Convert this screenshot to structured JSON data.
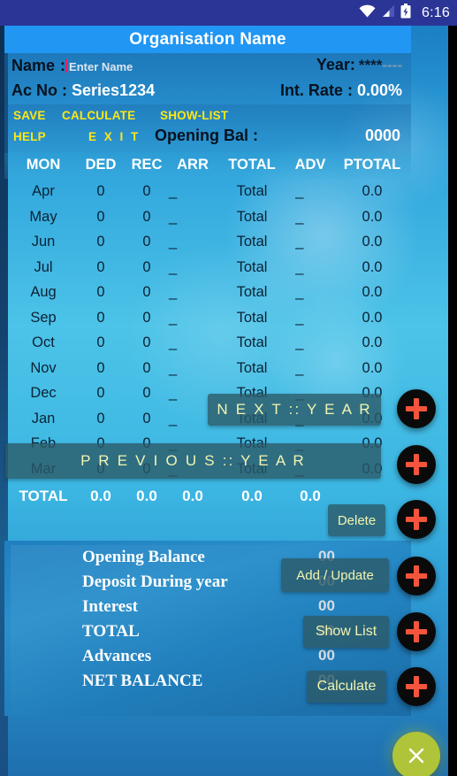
{
  "statusbar": {
    "time": "6:16",
    "icons": [
      "wifi-icon",
      "signal-icon",
      "battery-charging-icon"
    ]
  },
  "header": {
    "title": "Organisation Name",
    "name_label": "Name",
    "name_colon": ":",
    "name_placeholder": "Enter Name",
    "name_value": "",
    "year_label": "Year:",
    "year_stars": "****",
    "year_dashes": "----",
    "acno_label": "Ac No",
    "acno_colon": ":",
    "acno_value": "Series1234",
    "rate_label": "Int. Rate",
    "rate_colon": ":",
    "rate_value": "0.00%"
  },
  "menu": {
    "save": "SAVE",
    "calculate": "CALCULATE",
    "show_list": "SHOW-LIST",
    "help": "HELP",
    "exit": "E X I T",
    "opening_bal_label": "Opening Bal :",
    "opening_bal_value": "0000"
  },
  "table": {
    "columns": [
      "MON",
      "DED",
      "REC",
      "ARR",
      "TOTAL",
      "ADV",
      "PTOTAL"
    ],
    "rows": [
      {
        "mon": "Apr",
        "ded": "0",
        "rec": "0",
        "arr": "_",
        "total": "Total",
        "adv": "_",
        "ptotal": "0.0"
      },
      {
        "mon": "May",
        "ded": "0",
        "rec": "0",
        "arr": "_",
        "total": "Total",
        "adv": "_",
        "ptotal": "0.0"
      },
      {
        "mon": "Jun",
        "ded": "0",
        "rec": "0",
        "arr": "_",
        "total": "Total",
        "adv": "_",
        "ptotal": "0.0"
      },
      {
        "mon": "Jul",
        "ded": "0",
        "rec": "0",
        "arr": "_",
        "total": "Total",
        "adv": "_",
        "ptotal": "0.0"
      },
      {
        "mon": "Aug",
        "ded": "0",
        "rec": "0",
        "arr": "_",
        "total": "Total",
        "adv": "_",
        "ptotal": "0.0"
      },
      {
        "mon": "Sep",
        "ded": "0",
        "rec": "0",
        "arr": "_",
        "total": "Total",
        "adv": "_",
        "ptotal": "0.0"
      },
      {
        "mon": "Oct",
        "ded": "0",
        "rec": "0",
        "arr": "_",
        "total": "Total",
        "adv": "_",
        "ptotal": "0.0"
      },
      {
        "mon": "Nov",
        "ded": "0",
        "rec": "0",
        "arr": "_",
        "total": "Total",
        "adv": "_",
        "ptotal": "0.0"
      },
      {
        "mon": "Dec",
        "ded": "0",
        "rec": "0",
        "arr": "_",
        "total": "Total",
        "adv": "_",
        "ptotal": "0.0"
      },
      {
        "mon": "Jan",
        "ded": "0",
        "rec": "0",
        "arr": "_",
        "total": "Total",
        "adv": "_",
        "ptotal": "0.0"
      },
      {
        "mon": "Feb",
        "ded": "0",
        "rec": "0",
        "arr": "_",
        "total": "Total",
        "adv": "_",
        "ptotal": "0.0"
      },
      {
        "mon": "Mar",
        "ded": "0",
        "rec": "0",
        "arr": "_",
        "total": "Total",
        "adv": "_",
        "ptotal": "0.0"
      }
    ],
    "total_row": {
      "mon": "TOTAL",
      "ded": "0.0",
      "rec": "0.0",
      "arr": "0.0",
      "total": "0.0",
      "adv": "0.0",
      "ptotal": ""
    }
  },
  "summary": {
    "rows": [
      {
        "label": "Opening Balance",
        "value": "00"
      },
      {
        "label": "Deposit During year",
        "value": "00"
      },
      {
        "label": "Interest",
        "value": "00"
      },
      {
        "label": "TOTAL",
        "value": "00"
      },
      {
        "label": "Advances",
        "value": "00"
      },
      {
        "label": "NET BALANCE",
        "value": "00"
      }
    ]
  },
  "overlay_buttons": {
    "next_year": "N E X T :: Y E A R",
    "previous_year": "P R E V I O U S :: Y E A R",
    "delete": "Delete",
    "add_update": "Add / Update",
    "show_list": "Show List",
    "calculate": "Calculate"
  },
  "fab": {
    "add_icon": "plus-icon",
    "close_icon": "close-icon",
    "count": 6
  },
  "colors": {
    "statusbar": "#2b3595",
    "titlebar": "#2196f3",
    "menu_text": "#ffe714",
    "fab_bg": "#0a0a0a",
    "fab_plus": "#f4543c",
    "fab_close_bg": "#b0c43a",
    "overlay_bg": "rgba(44,90,104,.80)",
    "overlay_text": "#f2f5b0",
    "caret": "#e91e63"
  }
}
